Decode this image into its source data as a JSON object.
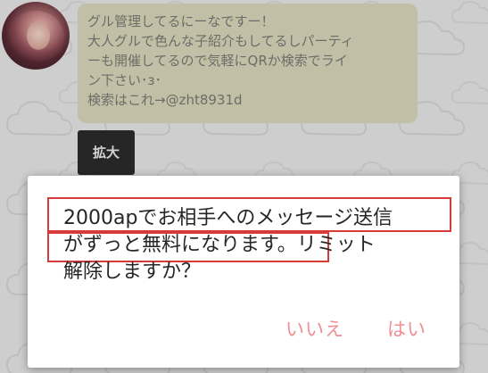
{
  "chat": {
    "message_lines": [
      "グル管理してるにーなですー！",
      "大人グルで色んな子紹介もしてるしパーティ",
      "ーも開催してるので気軽にQRか検索でライ",
      "ン下さい･з･",
      "検索はこれ→@zht8931d"
    ],
    "expand_label": "拡大"
  },
  "dialog": {
    "lines": [
      "2000apでお相手へのメッセージ送信",
      "がずっと無料になります。リミット",
      "解除しますか？"
    ],
    "no_label": "いいえ",
    "yes_label": "はい"
  },
  "colors": {
    "bubble": "#d7d6b9",
    "button_text": "#f08e93",
    "highlight": "#d83a3a"
  }
}
